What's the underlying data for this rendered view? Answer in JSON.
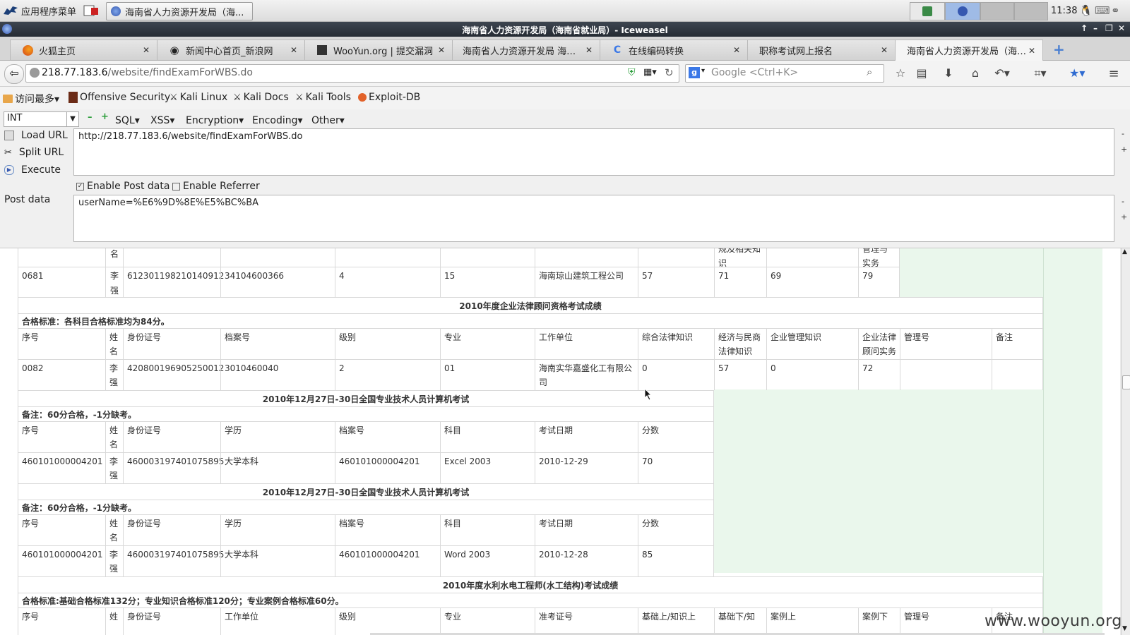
{
  "panel": {
    "app_menu": "应用程序菜单",
    "task_title": "海南省人力资源开发局（海...",
    "clock": "11:38"
  },
  "window": {
    "title": "海南省人力资源开发局（海南省就业局）- Iceweasel"
  },
  "tabs": [
    {
      "label": "火狐主页",
      "icon": "firefox-icon"
    },
    {
      "label": "新闻中心首页_新浪网",
      "icon": "sina-icon"
    },
    {
      "label": "WooYun.org | 提交漏洞",
      "icon": "wooyun-icon"
    },
    {
      "label": "海南省人力资源开发局 海南…",
      "icon": "none"
    },
    {
      "label": "在线编码转换",
      "icon": "google-icon"
    },
    {
      "label": "职称考试网上报名",
      "icon": "none"
    },
    {
      "label": "海南省人力资源开发局（海…",
      "icon": "page-icon",
      "active": true
    }
  ],
  "nav": {
    "url_host": "218.77.183.6",
    "url_path": "/website/findExamForWBS.do",
    "search_placeholder": "Google <Ctrl+K>"
  },
  "bookmarks": [
    {
      "label": "访问最多▾",
      "icon": "folder-icon"
    },
    {
      "label": "Offensive Security",
      "icon": "offsec-icon"
    },
    {
      "label": "Kali Linux",
      "icon": "kali-icon"
    },
    {
      "label": "Kali Docs",
      "icon": "kali-icon"
    },
    {
      "label": "Kali Tools",
      "icon": "kali-icon"
    },
    {
      "label": "Exploit-DB",
      "icon": "exploitdb-icon"
    }
  ],
  "hackbar": {
    "select_value": "INT",
    "menus": [
      "SQL▾",
      "XSS▾",
      "Encryption▾",
      "Encoding▾",
      "Other▾"
    ],
    "load_url": "Load URL",
    "split_url": "Split URL",
    "execute": "Execute",
    "url_value": "http://218.77.183.6/website/findExamForWBS.do",
    "enable_post": "Enable Post data",
    "enable_referrer": "Enable Referrer",
    "post_label": "Post data",
    "post_value": "userName=%E6%9D%8E%E5%BC%BA"
  },
  "content": {
    "top_partial": {
      "h_name_frag": "名",
      "h_c8_frag": "规及相关知识",
      "h_c10_frag": "管理与实务",
      "row": [
        "0681",
        "李强",
        "612301198210140912",
        "34104600366",
        "4",
        "15",
        "海南琼山建筑工程公司",
        "57",
        "71",
        "69",
        "79"
      ]
    },
    "legal": {
      "title": "2010年度企业法律顾问资格考试成绩",
      "note": "合格标准：各科目合格标准均为84分。",
      "headers": [
        "序号",
        "姓名",
        "身份证号",
        "档案号",
        "级别",
        "专业",
        "工作单位",
        "综合法律知识",
        "经济与民商法律知识",
        "企业管理知识",
        "企业法律顾问实务",
        "管理号",
        "备注"
      ],
      "row": [
        "0082",
        "李强",
        "420800196905250012",
        "3010460040",
        "2",
        "01",
        "海南实华嘉盛化工有限公司",
        "0",
        "57",
        "0",
        "72",
        "",
        ""
      ]
    },
    "computer1": {
      "title": "2010年12月27日-30日全国专业技术人员计算机考试",
      "note": "备注：60分合格，-1分缺考。",
      "headers": [
        "序号",
        "姓名",
        "身份证号",
        "学历",
        "档案号",
        "科目",
        "考试日期",
        "分数"
      ],
      "row": [
        "460101000004201",
        "李强",
        "460003197401075895",
        "大学本科",
        "460101000004201",
        "Excel 2003",
        "2010-12-29",
        "70"
      ]
    },
    "computer2": {
      "title": "2010年12月27日-30日全国专业技术人员计算机考试",
      "note": "备注：60分合格，-1分缺考。",
      "headers": [
        "序号",
        "姓名",
        "身份证号",
        "学历",
        "档案号",
        "科目",
        "考试日期",
        "分数"
      ],
      "row": [
        "460101000004201",
        "李强",
        "460003197401075895",
        "大学本科",
        "460101000004201",
        "Word 2003",
        "2010-12-28",
        "85"
      ]
    },
    "hydro": {
      "title": "2010年度水利水电工程师(水工结构)考试成绩",
      "note": "合格标准:基础合格标准132分；专业知识合格标准120分；专业案例合格标准60分。",
      "headers": [
        "序号",
        "姓",
        "身份证号",
        "工作单位",
        "级别",
        "专业",
        "准考证号",
        "基础上/知识上",
        "基础下/知",
        "案例上",
        "案例下",
        "管理号",
        "备注"
      ]
    }
  },
  "watermark": "www.wooyun.org"
}
